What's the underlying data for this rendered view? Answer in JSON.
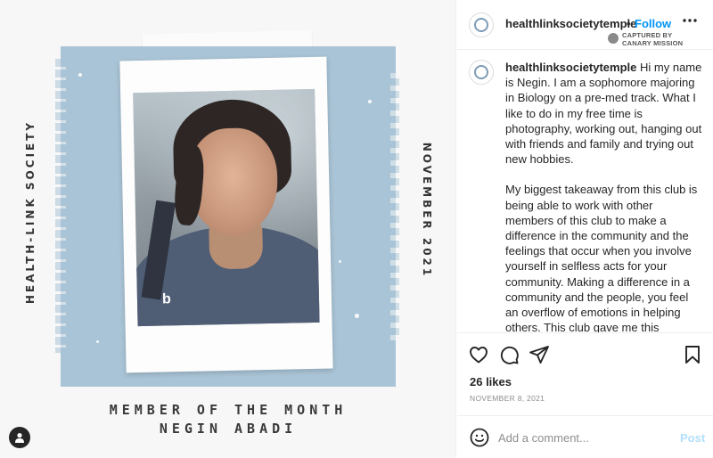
{
  "post": {
    "left_text": "HEALTH-LINK SOCIETY",
    "right_text": "NOVEMBER 2021",
    "caption_line1": "MEMBER OF THE MONTH",
    "caption_line2": "NEGIN ABADI",
    "colors": {
      "card": "#a9c4d6",
      "background": "#f7f7f7"
    },
    "user_tag_icon": "person-icon"
  },
  "header": {
    "username": "healthlinksocietytemple",
    "separator": "•",
    "follow_label": "Follow",
    "more_icon": "more-horizontal-icon",
    "watermark_line1": "CAPTURED BY",
    "watermark_line2": "CANARY MISSION"
  },
  "caption": {
    "username": "healthlinksocietytemple",
    "paragraph1": "Hi my name is Negin. I am a sophomore majoring in Biology on a pre-med track. What I like to do in my free time is photography, working out, hanging out with friends and family and trying out new hobbies.",
    "paragraph2": "My biggest takeaway from this club is being able to work with other members of this club to make a difference in the community and the feelings that occur when you involve yourself in selfless acts for your community. Making a difference in a community and the people, you feel an overflow of emotions in helping others. This club gave me this experience to open my eyes to how much of a difference I can make by"
  },
  "actions": {
    "icons": [
      "heart-icon",
      "comment-icon",
      "share-icon",
      "bookmark-icon"
    ]
  },
  "likes": "26 likes",
  "date": "NOVEMBER 8, 2021",
  "add_comment": {
    "placeholder": "Add a comment...",
    "post_label": "Post",
    "colors": {
      "post": "#b2dffc",
      "link": "#0095f6"
    }
  }
}
